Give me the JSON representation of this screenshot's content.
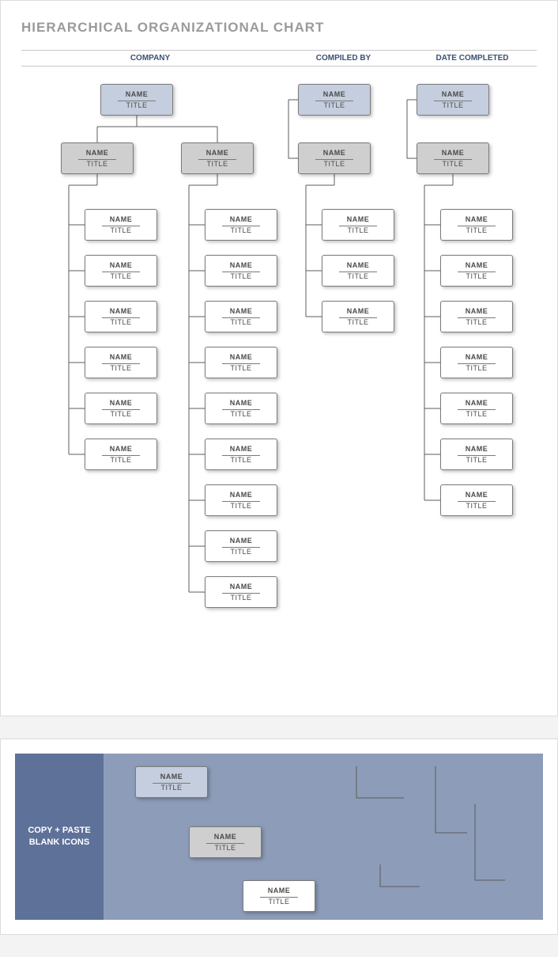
{
  "title": "HIERARCHICAL ORGANIZATIONAL CHART",
  "header": {
    "company": "COMPANY",
    "compiled": "COMPILED BY",
    "date": "DATE COMPLETED"
  },
  "labels": {
    "name": "NAME",
    "title": "TITLE"
  },
  "palette": {
    "side": "COPY + PASTE BLANK ICONS"
  },
  "chart_data": {
    "type": "org-chart",
    "blocks": [
      {
        "id": "root-a",
        "role": "top",
        "children": [
          "mgr-a1",
          "mgr-a2"
        ]
      },
      {
        "id": "mgr-a1",
        "role": "mid",
        "children": [
          "a1-1",
          "a1-2",
          "a1-3",
          "a1-4",
          "a1-5",
          "a1-6"
        ]
      },
      {
        "id": "mgr-a2",
        "role": "mid",
        "children": [
          "a2-1",
          "a2-2",
          "a2-3",
          "a2-4",
          "a2-5",
          "a2-6",
          "a2-7",
          "a2-8",
          "a2-9"
        ]
      },
      {
        "id": "root-b",
        "role": "top",
        "children": [
          "mgr-b"
        ]
      },
      {
        "id": "mgr-b",
        "role": "mid",
        "children": [
          "b-1",
          "b-2",
          "b-3"
        ]
      },
      {
        "id": "root-c",
        "role": "top",
        "children": [
          "mgr-c"
        ]
      },
      {
        "id": "mgr-c",
        "role": "mid",
        "children": [
          "c-1",
          "c-2",
          "c-3",
          "c-4",
          "c-5",
          "c-6",
          "c-7"
        ]
      }
    ],
    "palette_nodes": [
      "top",
      "mid",
      "leaf"
    ]
  }
}
